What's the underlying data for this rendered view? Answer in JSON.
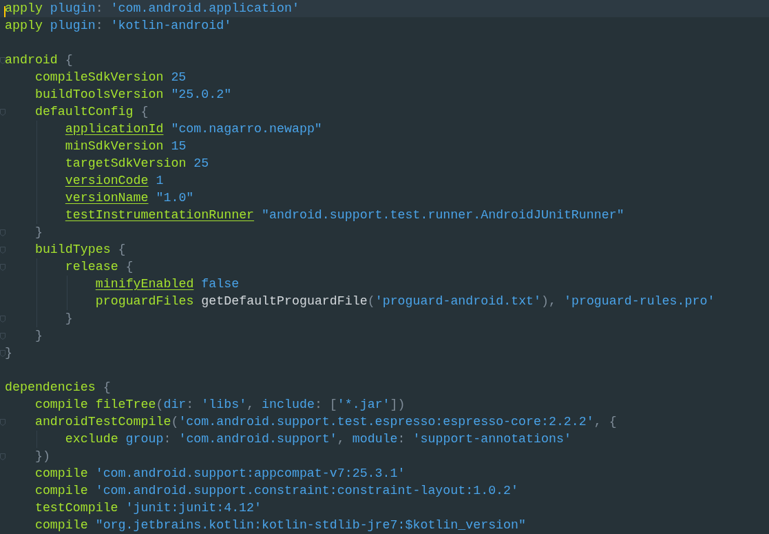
{
  "editor": {
    "lines": [
      {
        "kind": "code",
        "current": true,
        "fold": false,
        "tokens": [
          {
            "kind": "i",
            "t": "apply "
          },
          {
            "kind": "v",
            "t": "plugin"
          },
          {
            "kind": "s",
            "t": ": "
          },
          {
            "kind": "v",
            "t": "'com.android.application'"
          }
        ]
      },
      {
        "kind": "code",
        "current": false,
        "fold": false,
        "tokens": [
          {
            "kind": "i",
            "t": "apply "
          },
          {
            "kind": "v",
            "t": "plugin"
          },
          {
            "kind": "s",
            "t": ": "
          },
          {
            "kind": "v",
            "t": "'kotlin-android'"
          }
        ]
      },
      {
        "kind": "blank"
      },
      {
        "kind": "code",
        "current": false,
        "fold": true,
        "tokens": [
          {
            "kind": "i",
            "t": "android "
          },
          {
            "kind": "s",
            "t": "{"
          }
        ],
        "children": [
          {
            "kind": "code",
            "current": false,
            "fold": false,
            "tokens": [
              {
                "kind": "i",
                "t": "compileSdkVersion "
              },
              {
                "kind": "v",
                "t": "25"
              }
            ]
          },
          {
            "kind": "code",
            "current": false,
            "fold": false,
            "tokens": [
              {
                "kind": "i",
                "t": "buildToolsVersion "
              },
              {
                "kind": "v",
                "t": "\"25.0.2\""
              }
            ]
          },
          {
            "kind": "code",
            "current": false,
            "fold": true,
            "tokens": [
              {
                "kind": "i",
                "t": "defaultConfig "
              },
              {
                "kind": "s",
                "t": "{"
              }
            ],
            "children": [
              {
                "kind": "code",
                "current": false,
                "fold": false,
                "tokens": [
                  {
                    "kind": "p",
                    "t": "applicationId"
                  },
                  {
                    "kind": "v",
                    "t": " \"com.nagarro.newapp\""
                  }
                ]
              },
              {
                "kind": "code",
                "current": false,
                "fold": false,
                "tokens": [
                  {
                    "kind": "i",
                    "t": "minSdkVersion "
                  },
                  {
                    "kind": "v",
                    "t": "15"
                  }
                ]
              },
              {
                "kind": "code",
                "current": false,
                "fold": false,
                "tokens": [
                  {
                    "kind": "i",
                    "t": "targetSdkVersion "
                  },
                  {
                    "kind": "v",
                    "t": "25"
                  }
                ]
              },
              {
                "kind": "code",
                "current": false,
                "fold": false,
                "tokens": [
                  {
                    "kind": "p",
                    "t": "versionCode"
                  },
                  {
                    "kind": "v",
                    "t": " 1"
                  }
                ]
              },
              {
                "kind": "code",
                "current": false,
                "fold": false,
                "tokens": [
                  {
                    "kind": "p",
                    "t": "versionName"
                  },
                  {
                    "kind": "v",
                    "t": " \"1.0\""
                  }
                ]
              },
              {
                "kind": "code",
                "current": false,
                "fold": false,
                "tokens": [
                  {
                    "kind": "p",
                    "t": "testInstrumentationRunner"
                  },
                  {
                    "kind": "v",
                    "t": " \"android.support.test.runner.AndroidJUnitRunner\""
                  }
                ]
              }
            ]
          },
          {
            "kind": "code",
            "current": false,
            "fold": true,
            "tokens": [
              {
                "kind": "s",
                "t": "}"
              }
            ]
          },
          {
            "kind": "code",
            "current": false,
            "fold": true,
            "tokens": [
              {
                "kind": "i",
                "t": "buildTypes "
              },
              {
                "kind": "s",
                "t": "{"
              }
            ],
            "children": [
              {
                "kind": "code",
                "current": false,
                "fold": true,
                "tokens": [
                  {
                    "kind": "i",
                    "t": "release "
                  },
                  {
                    "kind": "s",
                    "t": "{"
                  }
                ],
                "children": [
                  {
                    "kind": "code",
                    "current": false,
                    "fold": false,
                    "tokens": [
                      {
                        "kind": "p",
                        "t": "minifyEnabled"
                      },
                      {
                        "kind": "v",
                        "t": " false"
                      }
                    ]
                  },
                  {
                    "kind": "code",
                    "current": false,
                    "fold": false,
                    "tokens": [
                      {
                        "kind": "i",
                        "t": "proguardFiles "
                      },
                      {
                        "kind": "c",
                        "t": "getDefaultProguardFile"
                      },
                      {
                        "kind": "s",
                        "t": "("
                      },
                      {
                        "kind": "v",
                        "t": "'proguard-android.txt'"
                      },
                      {
                        "kind": "s",
                        "t": "), "
                      },
                      {
                        "kind": "v",
                        "t": "'proguard-rules.pro'"
                      }
                    ]
                  }
                ]
              },
              {
                "kind": "code",
                "current": false,
                "fold": true,
                "tokens": [
                  {
                    "kind": "s",
                    "t": "}"
                  }
                ]
              }
            ]
          },
          {
            "kind": "code",
            "current": false,
            "fold": true,
            "tokens": [
              {
                "kind": "s",
                "t": "}"
              }
            ]
          }
        ]
      },
      {
        "kind": "code",
        "current": false,
        "fold": true,
        "tokens": [
          {
            "kind": "s",
            "t": "}"
          }
        ]
      },
      {
        "kind": "blank"
      },
      {
        "kind": "code",
        "current": false,
        "fold": false,
        "tokens": [
          {
            "kind": "i",
            "t": "dependencies "
          },
          {
            "kind": "s",
            "t": "{"
          }
        ],
        "children": [
          {
            "kind": "code",
            "current": false,
            "fold": false,
            "tokens": [
              {
                "kind": "i",
                "t": "compile fileTree"
              },
              {
                "kind": "s",
                "t": "("
              },
              {
                "kind": "v",
                "t": "dir"
              },
              {
                "kind": "s",
                "t": ": "
              },
              {
                "kind": "v",
                "t": "'libs'"
              },
              {
                "kind": "s",
                "t": ", "
              },
              {
                "kind": "v",
                "t": "include"
              },
              {
                "kind": "s",
                "t": ": ["
              },
              {
                "kind": "v",
                "t": "'*.jar'"
              },
              {
                "kind": "s",
                "t": "])"
              }
            ]
          },
          {
            "kind": "code",
            "current": false,
            "fold": true,
            "tokens": [
              {
                "kind": "i",
                "t": "androidTestCompile"
              },
              {
                "kind": "s",
                "t": "("
              },
              {
                "kind": "v",
                "t": "'com.android.support.test.espresso:espresso-core:2.2.2'"
              },
              {
                "kind": "s",
                "t": ", {"
              }
            ],
            "children": [
              {
                "kind": "code",
                "current": false,
                "fold": false,
                "tokens": [
                  {
                    "kind": "i",
                    "t": "exclude "
                  },
                  {
                    "kind": "v",
                    "t": "group"
                  },
                  {
                    "kind": "s",
                    "t": ": "
                  },
                  {
                    "kind": "v",
                    "t": "'com.android.support'"
                  },
                  {
                    "kind": "s",
                    "t": ", "
                  },
                  {
                    "kind": "v",
                    "t": "module"
                  },
                  {
                    "kind": "s",
                    "t": ": "
                  },
                  {
                    "kind": "v",
                    "t": "'support-annotations'"
                  }
                ]
              }
            ]
          },
          {
            "kind": "code",
            "current": false,
            "fold": true,
            "tokens": [
              {
                "kind": "s",
                "t": "})"
              }
            ]
          },
          {
            "kind": "code",
            "current": false,
            "fold": false,
            "tokens": [
              {
                "kind": "i",
                "t": "compile "
              },
              {
                "kind": "v",
                "t": "'com.android.support:appcompat-v7:25.3.1'"
              }
            ]
          },
          {
            "kind": "code",
            "current": false,
            "fold": false,
            "tokens": [
              {
                "kind": "i",
                "t": "compile "
              },
              {
                "kind": "v",
                "t": "'com.android.support.constraint:constraint-layout:1.0.2'"
              }
            ]
          },
          {
            "kind": "code",
            "current": false,
            "fold": false,
            "tokens": [
              {
                "kind": "i",
                "t": "testCompile "
              },
              {
                "kind": "v",
                "t": "'junit:junit:4.12'"
              }
            ]
          },
          {
            "kind": "code",
            "current": false,
            "fold": false,
            "tokens": [
              {
                "kind": "i",
                "t": "compile "
              },
              {
                "kind": "v",
                "t": "\"org.jetbrains.kotlin:kotlin-stdlib-jre7:$kotlin_version\""
              }
            ]
          }
        ]
      }
    ]
  }
}
